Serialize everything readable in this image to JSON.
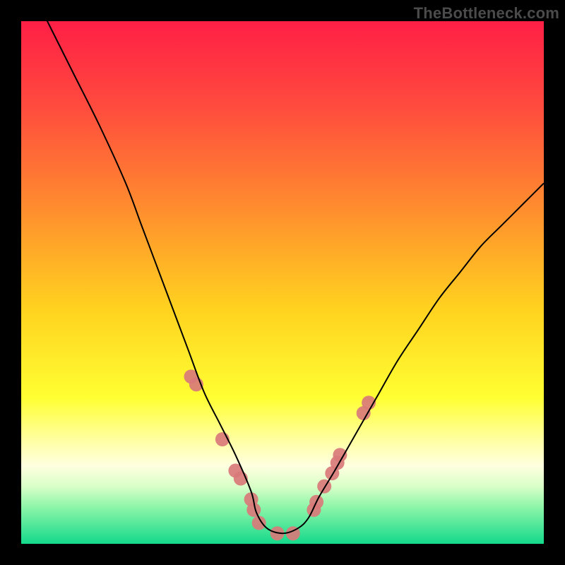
{
  "watermark": "TheBottleneck.com",
  "chart_data": {
    "type": "line",
    "title": "",
    "xlabel": "",
    "ylabel": "",
    "xlim": [
      0,
      100
    ],
    "ylim": [
      0,
      100
    ],
    "grid": false,
    "legend": false,
    "background": {
      "description": "Vertical gradient encoding bottleneck severity from top (bad) to bottom (good)",
      "stops": [
        {
          "pos": 0.0,
          "color": "#ff1f46"
        },
        {
          "pos": 0.16,
          "color": "#ff4a3e"
        },
        {
          "pos": 0.35,
          "color": "#ff8a2f"
        },
        {
          "pos": 0.55,
          "color": "#ffd21f"
        },
        {
          "pos": 0.72,
          "color": "#ffff32"
        },
        {
          "pos": 0.8,
          "color": "#ffffa0"
        },
        {
          "pos": 0.85,
          "color": "#ffffe0"
        },
        {
          "pos": 0.89,
          "color": "#d9ffc8"
        },
        {
          "pos": 0.93,
          "color": "#8cf5a8"
        },
        {
          "pos": 1.0,
          "color": "#14d98b"
        }
      ]
    },
    "series": [
      {
        "name": "bottleneck-curve",
        "color": "#000000",
        "stroke_width": 2,
        "x": [
          0,
          5,
          10,
          15,
          20,
          23,
          26,
          29,
          32,
          35,
          38,
          41,
          44,
          45,
          47,
          50,
          53,
          55,
          57,
          60,
          64,
          68,
          72,
          76,
          80,
          84,
          88,
          92,
          96,
          100
        ],
        "y": [
          110,
          100,
          90,
          80,
          69,
          61,
          53,
          45,
          37,
          29,
          23,
          17,
          10,
          6,
          3,
          2,
          3,
          5,
          9,
          14,
          21,
          28,
          35,
          41,
          47,
          52,
          57,
          61,
          65,
          69
        ]
      },
      {
        "name": "curve-markers",
        "color": "#d97a7a",
        "type": "scatter",
        "marker_radius": 10,
        "x": [
          32.5,
          33.5,
          38.5,
          41.0,
          42.0,
          44.0,
          44.5,
          45.5,
          49.0,
          52.0,
          56.0,
          56.5,
          58.0,
          59.5,
          60.5,
          61.0,
          65.5,
          66.5
        ],
        "y": [
          32.0,
          30.5,
          20.0,
          14.0,
          12.5,
          8.5,
          6.5,
          4.0,
          2.0,
          2.0,
          6.5,
          8.0,
          11.0,
          13.5,
          15.5,
          17.0,
          25.0,
          27.0
        ]
      }
    ]
  }
}
